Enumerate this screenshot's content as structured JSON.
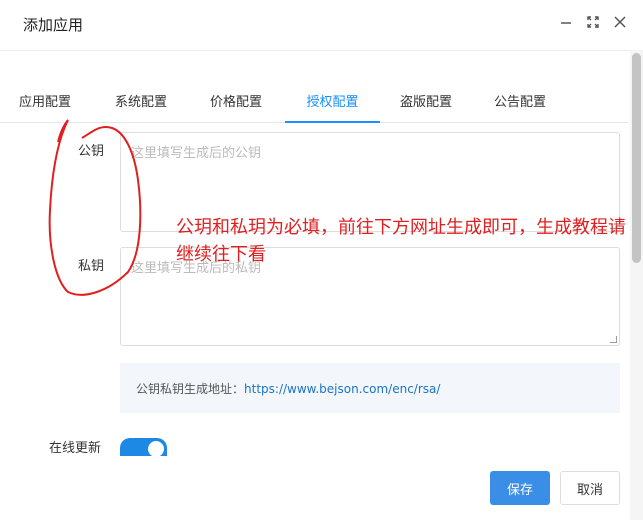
{
  "dialog": {
    "title": "添加应用",
    "icons": [
      "minimize-icon",
      "maximize-icon",
      "close-icon"
    ]
  },
  "tabs": [
    {
      "label": "应用配置",
      "active": false
    },
    {
      "label": "系统配置",
      "active": false
    },
    {
      "label": "价格配置",
      "active": false
    },
    {
      "label": "授权配置",
      "active": true
    },
    {
      "label": "盗版配置",
      "active": false
    },
    {
      "label": "公告配置",
      "active": false
    }
  ],
  "form": {
    "public_key_label": "公钥",
    "public_key_placeholder": "这里填写生成后的公钥",
    "private_key_label": "私钥",
    "private_key_placeholder": "这里填写生成后的私钥",
    "info_prefix": "公钥私钥生成地址：",
    "info_url": "https://www.bejson.com/enc/rsa/",
    "online_update_label": "在线更新",
    "online_update_on": true
  },
  "buttons": {
    "save": "保存",
    "cancel": "取消"
  },
  "annotation": {
    "text": "公玥和私玥为必填，前往下方网址生成即可，生成教程请继续往下看",
    "color": "#e02020"
  },
  "colors": {
    "accent": "#1890ff",
    "button_primary": "#3a8ee6",
    "switch": "#1e88e5"
  }
}
